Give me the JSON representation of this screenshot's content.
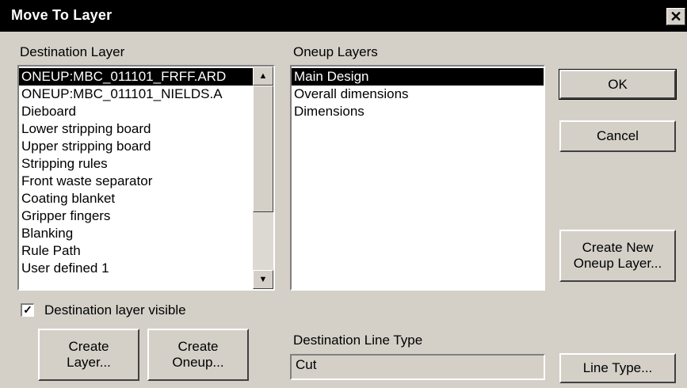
{
  "window": {
    "title": "Move To Layer",
    "close_glyph": "✕"
  },
  "destination_layer": {
    "label": "Destination Layer",
    "items": [
      "ONEUP:MBC_011101_FRFF.ARD",
      "ONEUP:MBC_011101_NIELDS.A",
      "Dieboard",
      "Lower stripping board",
      "Upper stripping board",
      "Stripping rules",
      "Front waste separator",
      "Coating blanket",
      "Gripper fingers",
      "Blanking",
      "Rule Path",
      "User defined 1"
    ],
    "selected_index": 0
  },
  "oneup_layers": {
    "label": "Oneup Layers",
    "items": [
      "Main Design",
      "Overall dimensions",
      "Dimensions"
    ],
    "selected_index": 0
  },
  "buttons": {
    "ok": "OK",
    "cancel": "Cancel",
    "create_new_oneup_line1": "Create New",
    "create_new_oneup_line2": "Oneup Layer...",
    "create_layer_line1": "Create",
    "create_layer_line2": "Layer...",
    "create_oneup_line1": "Create",
    "create_oneup_line2": "Oneup...",
    "line_type": "Line Type..."
  },
  "visible_checkbox": {
    "label": "Destination layer visible",
    "checked": true
  },
  "line_type": {
    "label": "Destination Line Type",
    "value": "Cut"
  },
  "icons": {
    "scroll_up": "up-arrow-icon",
    "scroll_down": "down-arrow-icon",
    "check": "checkmark-icon"
  }
}
